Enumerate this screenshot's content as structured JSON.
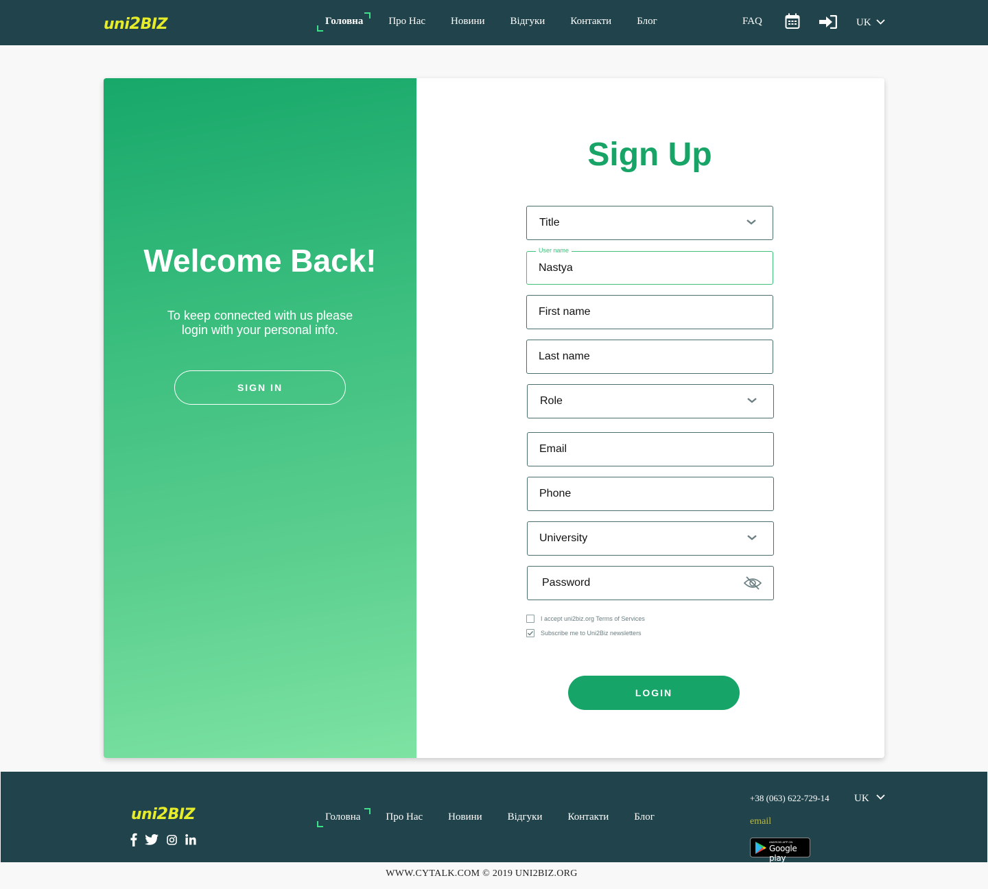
{
  "header": {
    "logo": {
      "pre": "uni",
      "two": "2",
      "post": "biz"
    },
    "nav": [
      "Головна",
      "Про Нас",
      "Новини",
      "Відгуки",
      "Контакти",
      "Блог"
    ],
    "faq": "FAQ",
    "lang": "UK",
    "icons": [
      "calendar-icon",
      "sign-in-icon",
      "chevron-down-icon"
    ]
  },
  "left_panel": {
    "title": "Welcome Back!",
    "subtitle": "To keep connected with us please login with your personal info.",
    "sign_in_label": "SIGN IN"
  },
  "form": {
    "title": "Sign Up",
    "title_select": "Title",
    "username_label": "User name",
    "username_value": "Nastya",
    "first_name": "First name",
    "last_name": "Last name",
    "role_select": "Role",
    "email": "Email",
    "phone": "Phone",
    "university_select": "University",
    "password": "Password",
    "terms_label": "I accept uni2biz.org Terms of Services",
    "terms_checked": false,
    "newsletter_label": "Subscribe me to Uni2Biz newsletters",
    "newsletter_checked": true,
    "login_label": "LOGIN"
  },
  "footer": {
    "nav": [
      "Головна",
      "Про Нас",
      "Новини",
      "Відгуки",
      "Контакти",
      "Блог"
    ],
    "phone": "+38 (063) 622-729-14",
    "email": "email",
    "lang": "UK",
    "google_play_small": "ANDROID APP ON",
    "google_play_big": "Google play",
    "social": [
      "facebook-icon",
      "twitter-icon",
      "instagram-icon",
      "linkedin-icon"
    ],
    "copyright": "WWW.CYTALK.COM © 2019 UNI2BIZ.ORG"
  },
  "colors": {
    "header_bg": "#21444c",
    "accent_green": "#17a468",
    "logo_yellow": "#e6ec2a"
  }
}
